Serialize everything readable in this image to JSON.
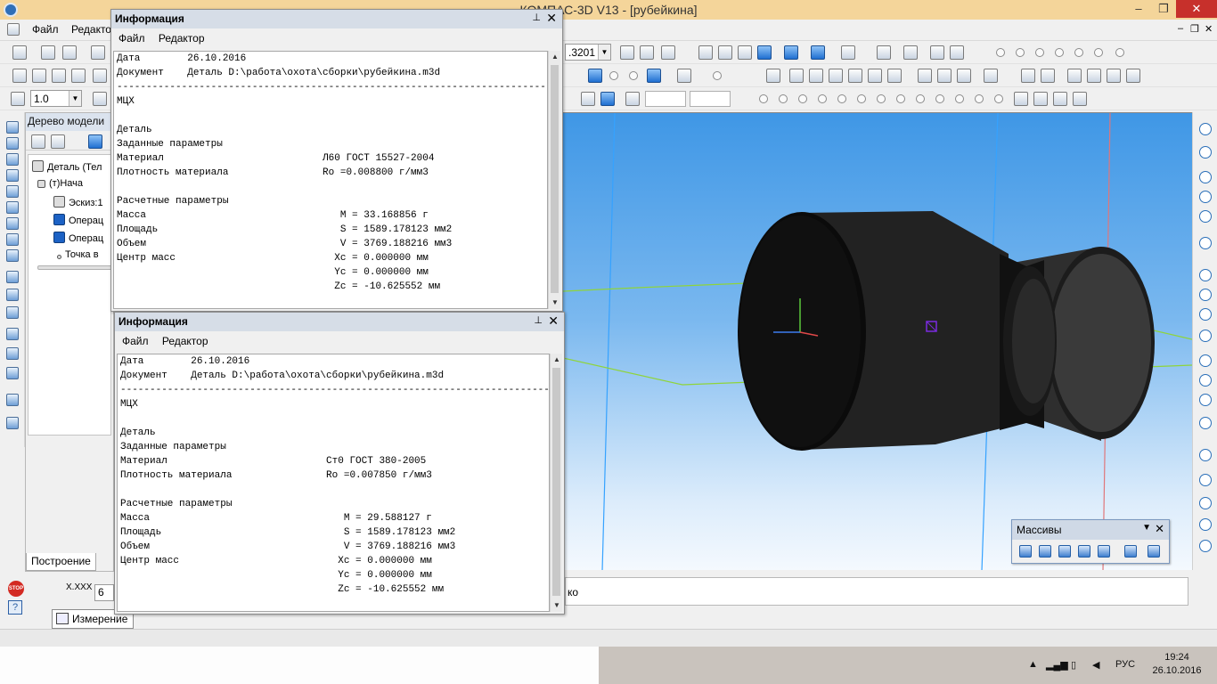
{
  "window": {
    "title": "КОМПАС-3D V13 - [рубейкина]",
    "minimize": "–",
    "maximize": "❐",
    "close": "✕"
  },
  "menubar": {
    "items": [
      "Файл",
      "Редактор"
    ]
  },
  "toolbar": {
    "scale_value": ".3201",
    "step_value": "1.0"
  },
  "tree": {
    "title": "Дерево модели",
    "nodes": [
      "Деталь (Тел",
      "(т)Нача",
      "Эскиз:1",
      "Операц",
      "Операц",
      "Точка в"
    ],
    "tab_label": "Построение"
  },
  "command": {
    "value_label": "X.XXX",
    "value": "6",
    "measure_tab": "Измерение",
    "right_field_tail": "ко"
  },
  "info1": {
    "title": "Информация",
    "menu": [
      "Файл",
      "Редактор"
    ],
    "lines": [
      "Дата        26.10.2016",
      "Документ    Деталь D:\\работа\\охота\\сборки\\рубейкина.m3d",
      "------------------------------------------------------------------------------",
      "МЦХ",
      "",
      "Деталь",
      "Заданные параметры",
      "Материал                           Л60 ГОСТ 15527-2004",
      "Плотность материала                Ro =0.008800 г/мм3",
      "",
      "Расчетные параметры",
      "Масса                                 M = 33.168856 г",
      "Площадь                               S = 1589.178123 мм2",
      "Объем                                 V = 3769.188216 мм3",
      "Центр масс                           Xc = 0.000000 мм",
      "                                     Yc = 0.000000 мм",
      "                                     Zc = -10.625552 мм"
    ]
  },
  "info2": {
    "title": "Информация",
    "menu": [
      "Файл",
      "Редактор"
    ],
    "lines": [
      "Дата        26.10.2016",
      "Документ    Деталь D:\\работа\\охота\\сборки\\рубейкина.m3d",
      "------------------------------------------------------------------------------",
      "МЦХ",
      "",
      "Деталь",
      "Заданные параметры",
      "Материал                           Ст0 ГОСТ 380-2005",
      "Плотность материала                Ro =0.007850 г/мм3",
      "",
      "Расчетные параметры",
      "Масса                                 M = 29.588127 г",
      "Площадь                               S = 1589.178123 мм2",
      "Объем                                 V = 3769.188216 мм3",
      "Центр масс                           Xc = 0.000000 мм",
      "                                     Yc = 0.000000 мм",
      "                                     Zc = -10.625552 мм"
    ]
  },
  "massivy": {
    "title": "Массивы"
  },
  "taskbar": {
    "language": "РУС",
    "time": "19:24",
    "date": "26.10.2016"
  },
  "colors": {
    "title_bar": "#f4d59a",
    "viewport_top": "#3f97e6",
    "viewport_bottom": "#f4f9fe",
    "sketch_lines": "#8fd43a"
  }
}
